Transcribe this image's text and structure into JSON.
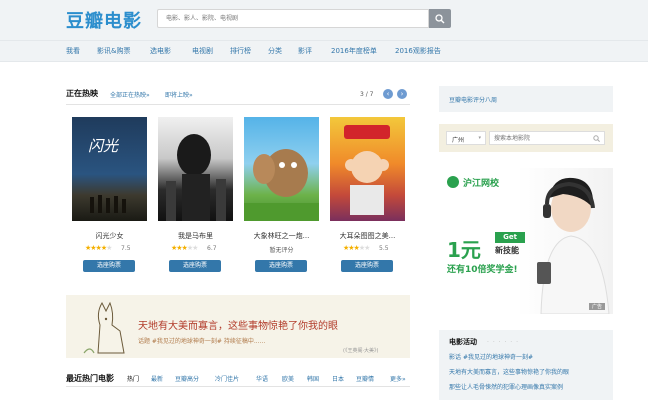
{
  "header": {
    "logo": "豆瓣电影",
    "search_placeholder": "电影、影人、影院、电视剧"
  },
  "nav": [
    "我看",
    "影讯&购票",
    "选电影",
    "电视剧",
    "排行榜",
    "分类",
    "影评",
    "2016年度榜单",
    "2016观影报告"
  ],
  "now_playing": {
    "title": "正在热映",
    "all_link": "全部正在热映»",
    "upcoming_link": "即将上映»",
    "pager": "3 / 7",
    "prev": "‹",
    "next": "›",
    "movies": [
      {
        "title": "闪光少女",
        "stars": 4,
        "rating": "7.5",
        "buy": "选座购票"
      },
      {
        "title": "我是马布里",
        "stars": 3,
        "rating": "6.7",
        "buy": "选座购票"
      },
      {
        "title": "大象林旺之一炮...",
        "stars": 0,
        "rating": "暂无评分",
        "buy": "选座购票"
      },
      {
        "title": "大耳朵图图之美...",
        "stars": 3,
        "rating": "5.5",
        "buy": "选座购票"
      }
    ]
  },
  "banner": {
    "headline": "天地有大美而寡言，这些事物惊艳了你我的眼",
    "subtitle": "话题 #我见过的地球神奇一刻# 持续征稿中......",
    "credit": "(《王英阁·大美》)"
  },
  "hot_movies": {
    "title": "最近热门电影",
    "tabs": [
      "热门",
      "最新",
      "豆瓣高分",
      "冷门佳片",
      "华语",
      "欧美",
      "韩国",
      "日本",
      "豆瓣情"
    ],
    "more": "更多»"
  },
  "sidebar": {
    "app_promo": "豆瓣电影评分八周",
    "city": "广州",
    "cinema_search_placeholder": "搜索本地影院",
    "ad": {
      "brand": "沪江网校",
      "big": "1元",
      "get": "Get",
      "skill": "新技能",
      "offer": "还有10倍奖学金!",
      "tag": "广告"
    },
    "activity_title": "电影活动",
    "activity_lines": [
      "那些让人毛骨悚然的犯罪心理画像真实案例",
      "天地有大美而寡言，这些事物惊艳了你我的眼"
    ],
    "activity_tag": "#我见过的地球神奇一刻#",
    "activity_label": "影话"
  },
  "colors": {
    "brand": "#2c8ecd",
    "link": "#3377aa",
    "star": "#f4b000",
    "ad_green": "#2aa14e"
  }
}
